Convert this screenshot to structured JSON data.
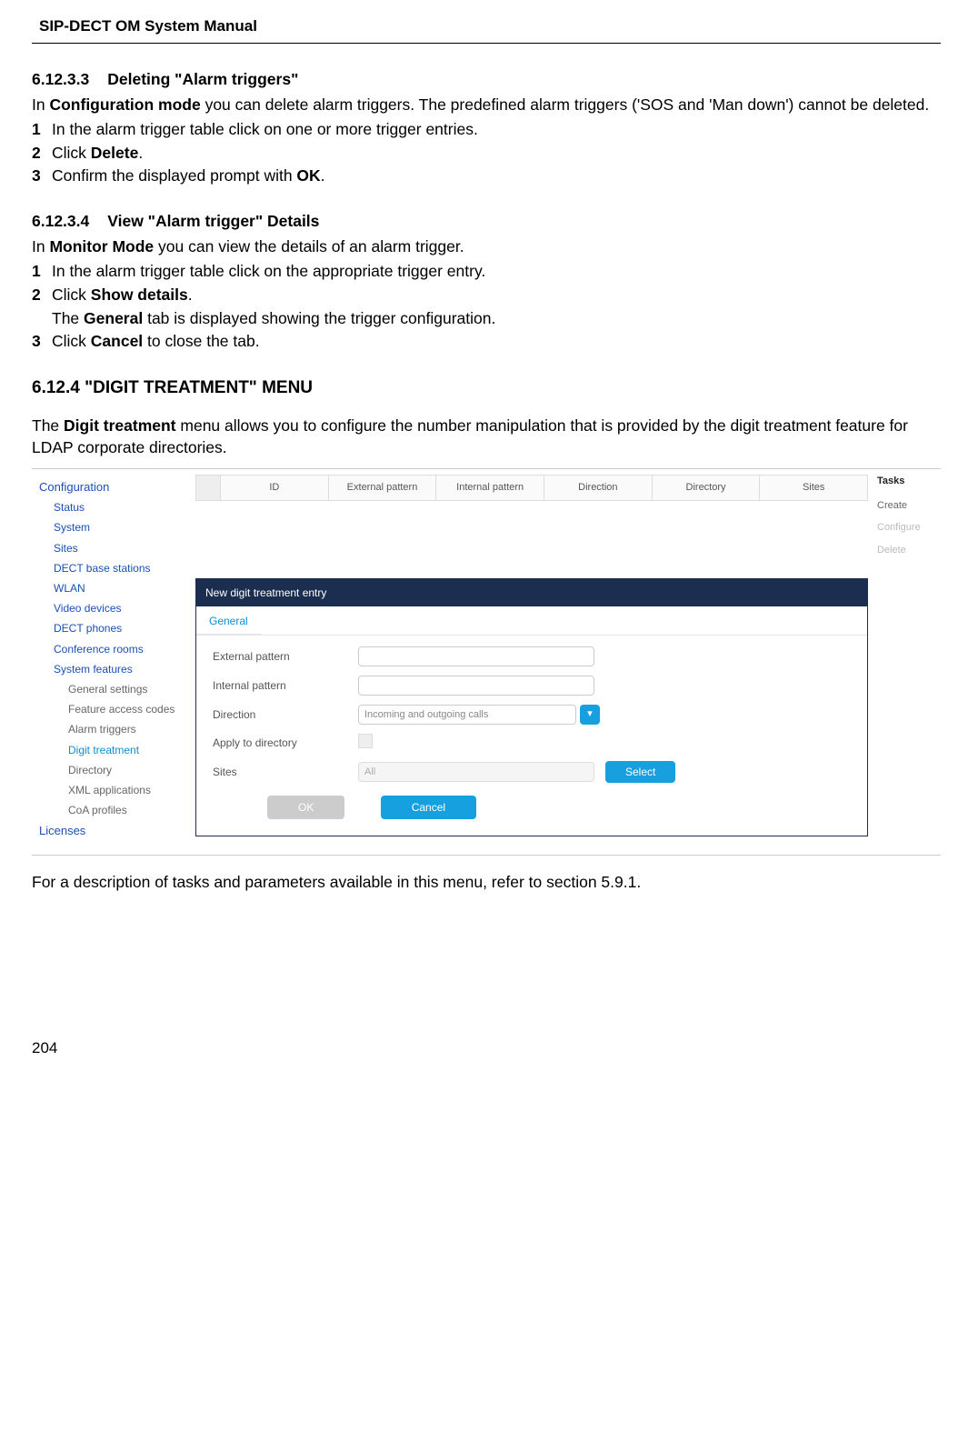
{
  "header": {
    "title": "SIP-DECT OM System Manual"
  },
  "sec1": {
    "num": "6.12.3.3",
    "title": "Deleting \"Alarm triggers\"",
    "intro_pre": "In ",
    "intro_bold": "Configuration mode",
    "intro_post": " you can delete alarm triggers. The predefined alarm triggers ('SOS and 'Man down') cannot be deleted.",
    "steps": [
      {
        "n": "1",
        "body": "In the alarm trigger table click on one or more trigger entries."
      },
      {
        "n": "2",
        "pre": "Click ",
        "bold": "Delete",
        "post": "."
      },
      {
        "n": "3",
        "pre": "Confirm the displayed prompt with ",
        "bold": "OK",
        "post": "."
      }
    ]
  },
  "sec2": {
    "num": "6.12.3.4",
    "title": "View \"Alarm trigger\" Details",
    "intro_pre": "In ",
    "intro_bold": "Monitor Mode",
    "intro_post": " you can view the details of an alarm trigger.",
    "steps": {
      "s1": {
        "n": "1",
        "body": "In the alarm trigger table click on the appropriate trigger entry."
      },
      "s2": {
        "n": "2",
        "pre": "Click ",
        "bold": "Show details",
        "post": "."
      },
      "s2b": {
        "pre": "The ",
        "bold": "General",
        "post": " tab is displayed showing the trigger configuration."
      },
      "s3": {
        "n": "3",
        "pre": "Click ",
        "bold": "Cancel",
        "post": " to close the tab."
      }
    }
  },
  "sec3": {
    "title": "6.12.4 \"DIGIT TREATMENT\" MENU",
    "para_pre": "The ",
    "para_bold": "Digit treatment",
    "para_post": " menu allows you to configure the number manipulation that is provided by the digit treatment feature for LDAP corporate directories."
  },
  "fig": {
    "nav": {
      "root": "Configuration",
      "items1": [
        "Status",
        "System",
        "Sites",
        "DECT base stations",
        "WLAN",
        "Video devices",
        "DECT phones",
        "Conference rooms",
        "System features"
      ],
      "items2": [
        "General settings",
        "Feature access codes",
        "Alarm triggers",
        "Digit treatment",
        "Directory",
        "XML applications",
        "CoA profiles"
      ],
      "active": "Digit treatment",
      "last0": "Licenses"
    },
    "table_headers": [
      "",
      "ID",
      "External pattern",
      "Internal pattern",
      "Direction",
      "Directory",
      "Sites"
    ],
    "panel": {
      "title": "New digit treatment entry",
      "tab": "General",
      "rows": {
        "ext": "External pattern",
        "int": "Internal pattern",
        "dir": "Direction",
        "dir_value": "Incoming and outgoing calls",
        "apply": "Apply to directory",
        "sites": "Sites",
        "sites_value": "All",
        "select_btn": "Select"
      },
      "ok": "OK",
      "cancel": "Cancel"
    },
    "tasks": {
      "head": "Tasks",
      "items": [
        "Create",
        "Configure",
        "Delete"
      ]
    }
  },
  "after_fig": "For a description of tasks and parameters available in this menu, refer to section 5.9.1.",
  "footer": {
    "page": "204"
  }
}
